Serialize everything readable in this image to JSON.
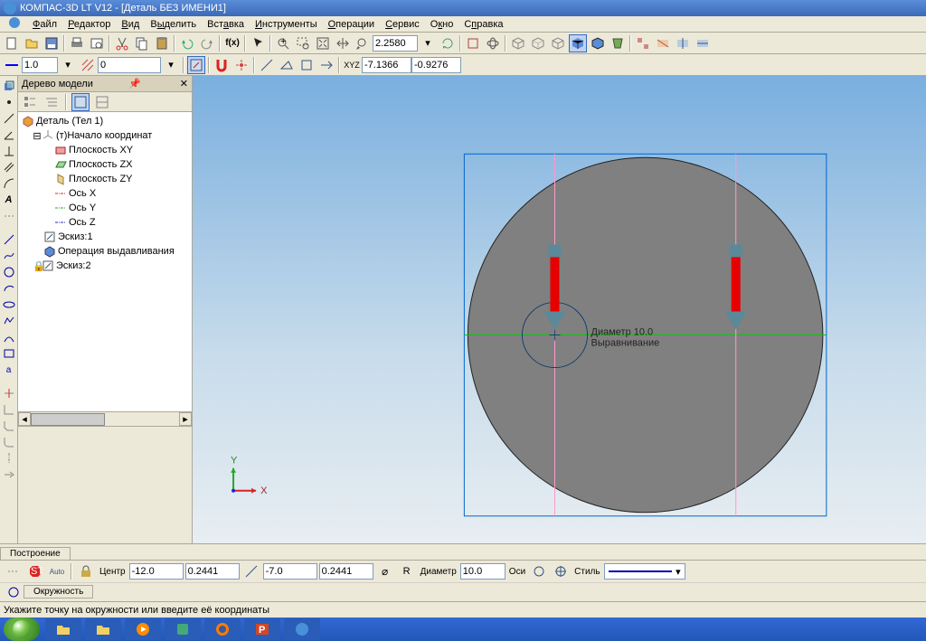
{
  "title": "КОМПАС-3D LT V12 - [Деталь БЕЗ ИМЕНИ1]",
  "menu": {
    "file": "Файл",
    "edit": "Редактор",
    "view": "Вид",
    "select": "Выделить",
    "insert": "Вставка",
    "tools": "Инструменты",
    "operations": "Операции",
    "service": "Сервис",
    "window": "Окно",
    "help": "Справка"
  },
  "toolbar1": {
    "zoom": "2.2580",
    "coord_x": "-7.1366",
    "coord_y": "-0.9276"
  },
  "toolbar2": {
    "val1": "1.0",
    "val2": "0"
  },
  "tree": {
    "title": "Дерево модели",
    "root": "Деталь (Тел 1)",
    "origin": "(т)Начало координат",
    "plane_xy": "Плоскость XY",
    "plane_zx": "Плоскость ZX",
    "plane_zy": "Плоскость ZY",
    "axis_x": "Ось X",
    "axis_y": "Ось Y",
    "axis_z": "Ось Z",
    "sketch1": "Эскиз:1",
    "extrude": "Операция выдавливания",
    "sketch2": "Эскиз:2"
  },
  "viewport": {
    "diameter_label": "Диаметр 10.0",
    "align_label": "Выравнивание",
    "axis_x": "X",
    "axis_y": "Y"
  },
  "bottom_tab": "Построение",
  "property": {
    "center_label": "Центр",
    "center_x": "-12.0",
    "center_y": "0.2441",
    "point_x": "-7.0",
    "point_y": "0.2441",
    "diam_label": "Диаметр",
    "diam_val": "10.0",
    "axes_label": "Оси",
    "style_label": "Стиль",
    "tab_circle": "Окружность"
  },
  "status": "Укажите точку на окружности или введите её координаты",
  "chart_data": {
    "type": "diagram",
    "description": "CAD viewport showing a gray extruded circular disk in front view with a sketch circle (diameter 10.0) being drawn near center. Two red constraint arrows point downward. Selection rectangle (blue) surrounds the part. Green horizontal line through center, pink vertical guide lines."
  }
}
